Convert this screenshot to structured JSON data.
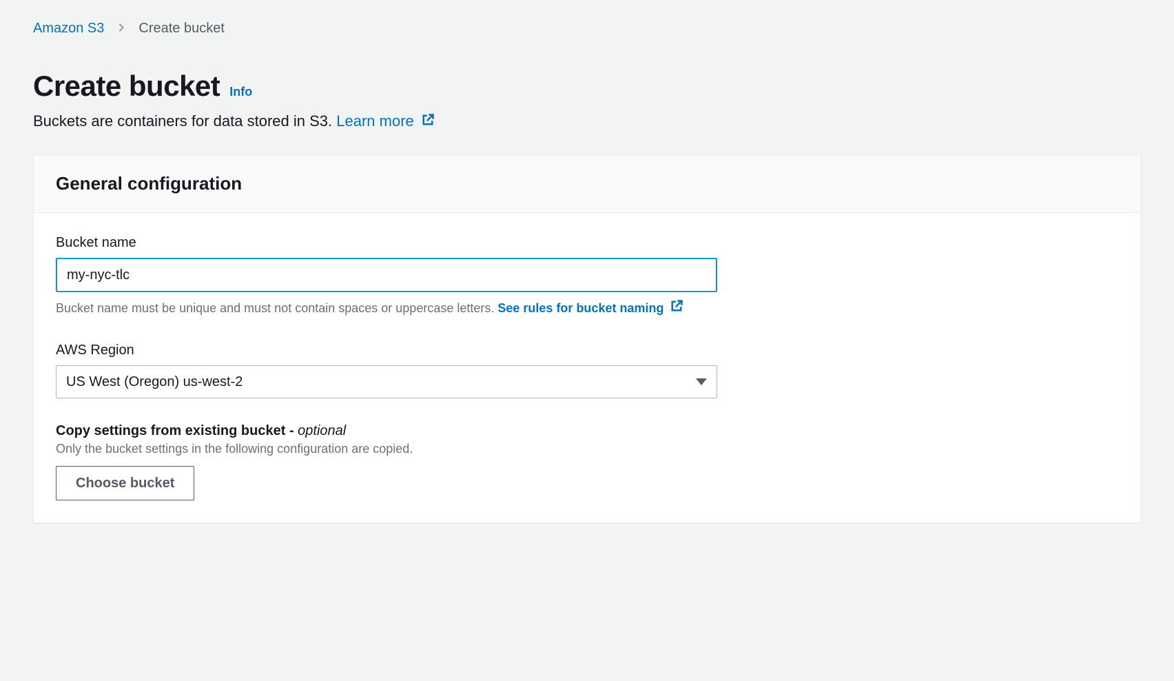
{
  "breadcrumb": {
    "parent": "Amazon S3",
    "current": "Create bucket"
  },
  "header": {
    "title": "Create bucket",
    "info_label": "Info",
    "subtitle": "Buckets are containers for data stored in S3.",
    "learn_more": "Learn more"
  },
  "panel": {
    "title": "General configuration",
    "bucket_name": {
      "label": "Bucket name",
      "value": "my-nyc-tlc",
      "hint": "Bucket name must be unique and must not contain spaces or uppercase letters.",
      "rules_link": "See rules for bucket naming"
    },
    "region": {
      "label": "AWS Region",
      "value": "US West (Oregon) us-west-2"
    },
    "copy_settings": {
      "label": "Copy settings from existing bucket - ",
      "optional": "optional",
      "hint": "Only the bucket settings in the following configuration are copied.",
      "button": "Choose bucket"
    }
  }
}
